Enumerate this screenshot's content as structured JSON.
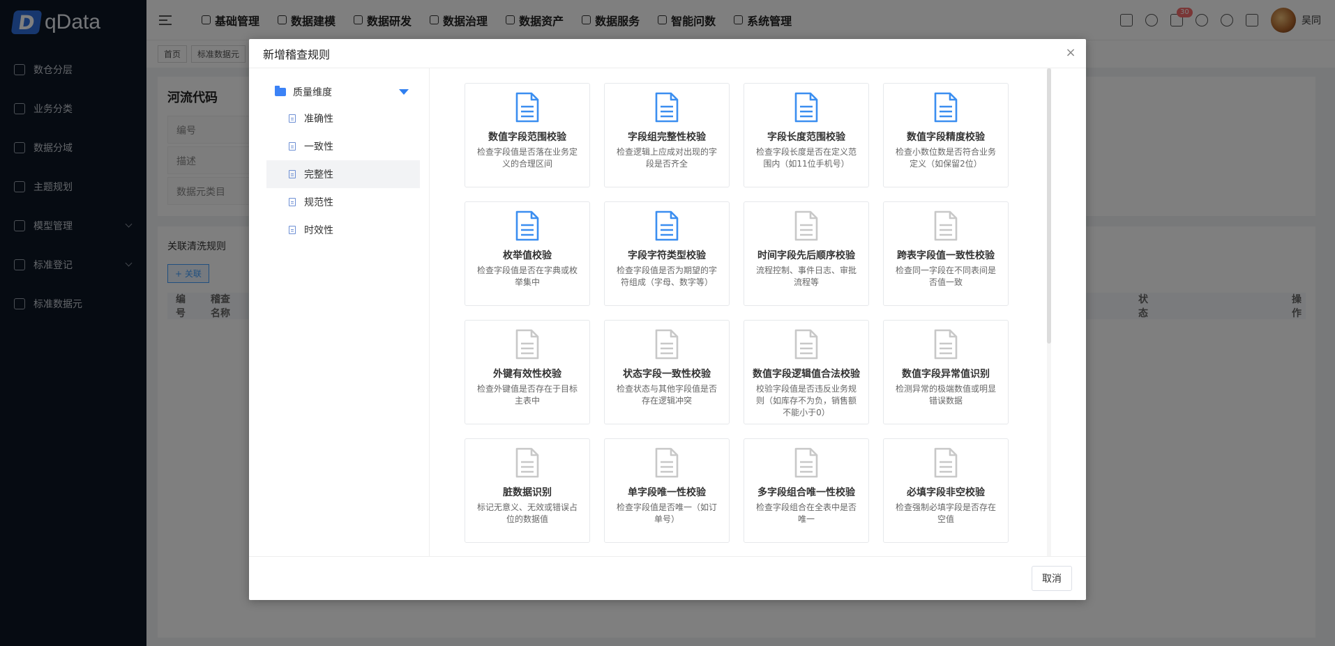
{
  "app": {
    "logo_text": "qData",
    "logo_mark": "D"
  },
  "sidebar": {
    "items": [
      {
        "label": "数仓分层",
        "icon": "layers-icon",
        "expandable": false
      },
      {
        "label": "业务分类",
        "icon": "list-icon",
        "expandable": false
      },
      {
        "label": "数据分域",
        "icon": "domain-icon",
        "expandable": false
      },
      {
        "label": "主题规划",
        "icon": "topic-icon",
        "expandable": false
      },
      {
        "label": "模型管理",
        "icon": "model-icon",
        "expandable": true
      },
      {
        "label": "标准登记",
        "icon": "register-icon",
        "expandable": true
      },
      {
        "label": "标准数据元",
        "icon": "data-element-icon",
        "expandable": false
      }
    ]
  },
  "topnav": {
    "items": [
      "基础管理",
      "数据建模",
      "数据研发",
      "数据治理",
      "数据资产",
      "数据服务",
      "智能问数",
      "系统管理"
    ],
    "notification_count": "30",
    "username": "吴同"
  },
  "tabs": [
    "首页",
    "标准数据元"
  ],
  "background": {
    "card_title": "河流代码",
    "form_labels": [
      "编号",
      "描述",
      "数据元类目"
    ],
    "section_title": "关联清洗规则",
    "link_button": "+ 关联",
    "table_headers": [
      "编号",
      "稽查名称",
      "状态",
      "操作"
    ]
  },
  "dialog": {
    "title": "新增稽查规则",
    "cancel_label": "取消",
    "tree": {
      "root": "质量维度",
      "children": [
        {
          "label": "准确性",
          "active": false
        },
        {
          "label": "一致性",
          "active": false
        },
        {
          "label": "完整性",
          "active": true
        },
        {
          "label": "规范性",
          "active": false
        },
        {
          "label": "时效性",
          "active": false
        }
      ]
    },
    "rules": [
      {
        "name": "数值字段范围校验",
        "desc": "检查字段值是否落在业务定义的合理区间",
        "enabled": true
      },
      {
        "name": "字段组完整性校验",
        "desc": "检查逻辑上应成对出现的字段是否齐全",
        "enabled": true
      },
      {
        "name": "字段长度范围校验",
        "desc": "检查字段长度是否在定义范围内（如11位手机号）",
        "enabled": true
      },
      {
        "name": "数值字段精度校验",
        "desc": "检查小数位数是否符合业务定义（如保留2位）",
        "enabled": true
      },
      {
        "name": "枚举值校验",
        "desc": "检查字段值是否在字典或枚举集中",
        "enabled": true
      },
      {
        "name": "字段字符类型校验",
        "desc": "检查字段值是否为期望的字符组成（字母、数字等）",
        "enabled": true
      },
      {
        "name": "时间字段先后顺序校验",
        "desc": "流程控制、事件日志、审批流程等",
        "enabled": false
      },
      {
        "name": "跨表字段值一致性校验",
        "desc": "检查同一字段在不同表间是否值一致",
        "enabled": false
      },
      {
        "name": "外键有效性校验",
        "desc": "检查外键值是否存在于目标主表中",
        "enabled": false
      },
      {
        "name": "状态字段一致性校验",
        "desc": "检查状态与其他字段值是否存在逻辑冲突",
        "enabled": false
      },
      {
        "name": "数值字段逻辑值合法校验",
        "desc": "校验字段值是否违反业务规则（如库存不为负，销售额不能小于0）",
        "enabled": false
      },
      {
        "name": "数值字段异常值识别",
        "desc": "检测异常的极端数值或明显错误数据",
        "enabled": false
      },
      {
        "name": "脏数据识别",
        "desc": "标记无意义、无效或错误占位的数据值",
        "enabled": false
      },
      {
        "name": "单字段唯一性校验",
        "desc": "检查字段值是否唯一（如订单号）",
        "enabled": false
      },
      {
        "name": "多字段组合唯一性校验",
        "desc": "检查字段组合在全表中是否唯一",
        "enabled": false
      },
      {
        "name": "必填字段非空校验",
        "desc": "检查强制必填字段是否存在空值",
        "enabled": false
      }
    ]
  },
  "colors": {
    "enabled_icon": "#3b8ef0",
    "disabled_icon": "#c8c8c8",
    "accent": "#409eff",
    "sidebar_bg": "#0c1624"
  }
}
